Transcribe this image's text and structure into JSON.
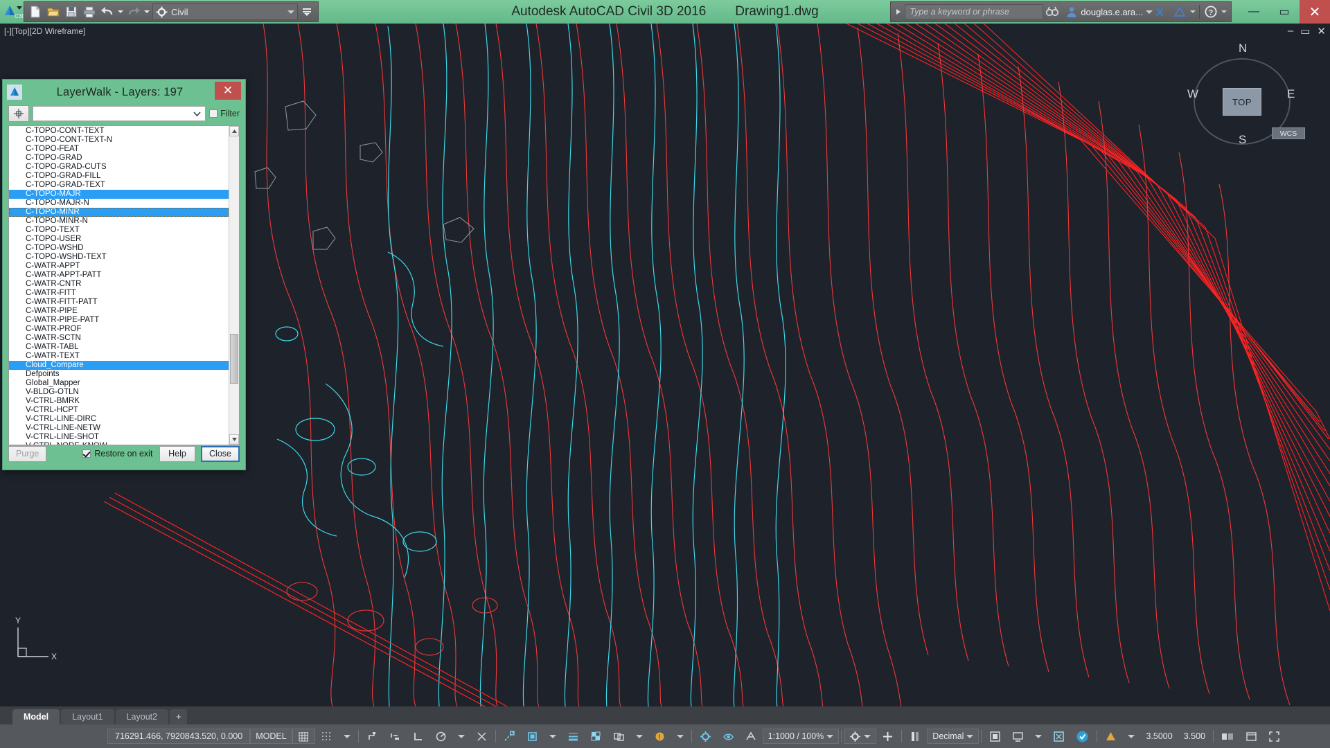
{
  "titlebar": {
    "app_title": "Autodesk AutoCAD Civil 3D 2016",
    "document_title": "Drawing1.dwg",
    "workspace": "Civil",
    "search_placeholder": "Type a keyword or phrase",
    "user": "douglas.e.ara...",
    "quick_access": [
      {
        "name": "new-icon",
        "label": "New"
      },
      {
        "name": "open-icon",
        "label": "Open"
      },
      {
        "name": "save-icon",
        "label": "Save"
      },
      {
        "name": "plot-icon",
        "label": "Plot"
      },
      {
        "name": "undo-icon",
        "label": "Undo"
      },
      {
        "name": "redo-icon",
        "label": "Redo"
      }
    ],
    "window_controls": {
      "minimize": "—",
      "maximize": "▭",
      "close": "✕"
    }
  },
  "canvas": {
    "viewport_label": "[-][Top][2D Wireframe]",
    "doc_controls": {
      "minimize": "–",
      "restore": "▭",
      "close": "✕"
    },
    "viewcube": {
      "top_face": "TOP",
      "north": "N",
      "south": "S",
      "east": "E",
      "west": "W",
      "wcs": "WCS"
    },
    "ucs": {
      "y_axis": "Y",
      "x_axis": "X"
    },
    "colors": {
      "background": "#1d222b",
      "contour_major": "#ff2d2d",
      "contour_minor": "#f07070",
      "water": "#3fd8e8",
      "misc": "#8f9aa5"
    }
  },
  "layerwalk": {
    "title": "LayerWalk - Layers: 197",
    "filter_label": "Filter",
    "filter_checked": false,
    "filter_value": "",
    "pick_icon": "pick-point-icon",
    "layers": [
      {
        "name": "C-TOPO-CONT-TEXT",
        "selected": false
      },
      {
        "name": "C-TOPO-CONT-TEXT-N",
        "selected": false
      },
      {
        "name": "C-TOPO-FEAT",
        "selected": false
      },
      {
        "name": "C-TOPO-GRAD",
        "selected": false
      },
      {
        "name": "C-TOPO-GRAD-CUTS",
        "selected": false
      },
      {
        "name": "C-TOPO-GRAD-FILL",
        "selected": false
      },
      {
        "name": "C-TOPO-GRAD-TEXT",
        "selected": false
      },
      {
        "name": "C-TOPO-MAJR",
        "selected": true
      },
      {
        "name": "C-TOPO-MAJR-N",
        "selected": false
      },
      {
        "name": "C-TOPO-MINR",
        "selected": true,
        "focused": true
      },
      {
        "name": "C-TOPO-MINR-N",
        "selected": false
      },
      {
        "name": "C-TOPO-TEXT",
        "selected": false
      },
      {
        "name": "C-TOPO-USER",
        "selected": false
      },
      {
        "name": "C-TOPO-WSHD",
        "selected": false
      },
      {
        "name": "C-TOPO-WSHD-TEXT",
        "selected": false
      },
      {
        "name": "C-WATR-APPT",
        "selected": false
      },
      {
        "name": "C-WATR-APPT-PATT",
        "selected": false
      },
      {
        "name": "C-WATR-CNTR",
        "selected": false
      },
      {
        "name": "C-WATR-FITT",
        "selected": false
      },
      {
        "name": "C-WATR-FITT-PATT",
        "selected": false
      },
      {
        "name": "C-WATR-PIPE",
        "selected": false
      },
      {
        "name": "C-WATR-PIPE-PATT",
        "selected": false
      },
      {
        "name": "C-WATR-PROF",
        "selected": false
      },
      {
        "name": "C-WATR-SCTN",
        "selected": false
      },
      {
        "name": "C-WATR-TABL",
        "selected": false
      },
      {
        "name": "C-WATR-TEXT",
        "selected": false
      },
      {
        "name": "Cloud_Compare",
        "selected": true
      },
      {
        "name": "Defpoints",
        "selected": false
      },
      {
        "name": "Global_Mapper",
        "selected": false
      },
      {
        "name": "V-BLDG-OTLN",
        "selected": false
      },
      {
        "name": "V-CTRL-BMRK",
        "selected": false
      },
      {
        "name": "V-CTRL-HCPT",
        "selected": false
      },
      {
        "name": "V-CTRL-LINE-DIRC",
        "selected": false
      },
      {
        "name": "V-CTRL-LINE-NETW",
        "selected": false
      },
      {
        "name": "V-CTRL-LINE-SHOT",
        "selected": false
      },
      {
        "name": "V-CTRL-NODE-KNOW",
        "selected": false
      }
    ],
    "buttons": {
      "purge": "Purge",
      "restore_on_exit": "Restore on exit",
      "restore_accesskey": "R",
      "help": "Help",
      "help_accesskey": "H",
      "close": "Close",
      "close_accesskey": "C"
    },
    "restore_checked": true,
    "close_button": "✕"
  },
  "layout_tabs": {
    "tabs": [
      {
        "label": "Model",
        "active": true
      },
      {
        "label": "Layout1",
        "active": false
      },
      {
        "label": "Layout2",
        "active": false
      }
    ],
    "add_tab": "+"
  },
  "statusbar": {
    "coordinates": "716291.466, 7920843.520, 0.000",
    "space": "MODEL",
    "annotation_scale": "1:1000 / 100%",
    "units": "Decimal",
    "lineweight_current": "3.5000",
    "lineweight_display": "3.500",
    "toggles": [
      {
        "name": "grid-display-icon",
        "label": "Grid Display"
      },
      {
        "name": "snap-mode-icon",
        "label": "Snap Mode"
      },
      {
        "name": "infer-constraints-icon",
        "label": "Infer Constraints"
      },
      {
        "name": "dynamic-input-icon",
        "label": "Dynamic Input"
      },
      {
        "name": "ortho-mode-icon",
        "label": "Ortho Mode"
      },
      {
        "name": "polar-tracking-icon",
        "label": "Polar Tracking"
      },
      {
        "name": "isometric-drafting-icon",
        "label": "Isometric Drafting"
      },
      {
        "name": "object-snap-tracking-icon",
        "label": "Object Snap Tracking"
      },
      {
        "name": "object-snap-icon",
        "label": "Object Snap"
      },
      {
        "name": "lineweight-icon",
        "label": "Show/Hide Lineweight"
      },
      {
        "name": "transparency-icon",
        "label": "Show/Hide Transparency"
      },
      {
        "name": "selection-cycling-icon",
        "label": "Selection Cycling"
      },
      {
        "name": "annotation-monitor-icon",
        "label": "Annotation Monitor"
      },
      {
        "name": "workspace-switching-icon",
        "label": "Workspace Switching"
      },
      {
        "name": "annotation-visibility-icon",
        "label": "Annotation Visibility"
      },
      {
        "name": "autoscale-icon",
        "label": "Automatically Add Scales"
      },
      {
        "name": "hardware-acceleration-icon",
        "label": "Hardware Acceleration"
      },
      {
        "name": "clean-screen-icon",
        "label": "Clean Screen"
      },
      {
        "name": "customization-icon",
        "label": "Customization"
      }
    ]
  }
}
